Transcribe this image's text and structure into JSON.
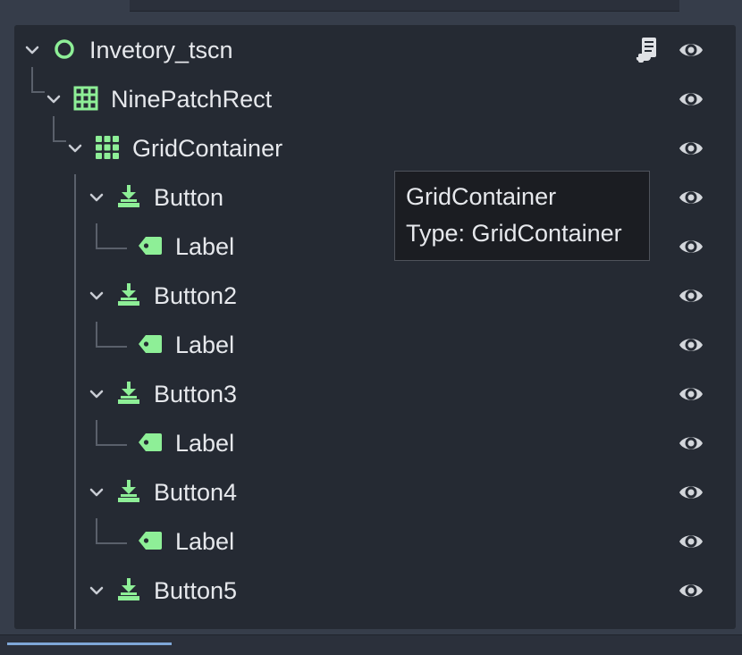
{
  "tree": {
    "nodes": [
      {
        "label": "Invetory_tscn",
        "icon": "node-circle-icon",
        "depth": 0
      },
      {
        "label": "NinePatchRect",
        "icon": "ninepatchrect-icon",
        "depth": 1
      },
      {
        "label": "GridContainer",
        "icon": "gridcontainer-icon",
        "depth": 2
      },
      {
        "label": "Button",
        "icon": "button-icon",
        "depth": 3
      },
      {
        "label": "Label",
        "icon": "label-icon",
        "depth": 4
      },
      {
        "label": "Button2",
        "icon": "button-icon",
        "depth": 3
      },
      {
        "label": "Label",
        "icon": "label-icon",
        "depth": 4
      },
      {
        "label": "Button3",
        "icon": "button-icon",
        "depth": 3
      },
      {
        "label": "Label",
        "icon": "label-icon",
        "depth": 4
      },
      {
        "label": "Button4",
        "icon": "button-icon",
        "depth": 3
      },
      {
        "label": "Label",
        "icon": "label-icon",
        "depth": 4
      },
      {
        "label": "Button5",
        "icon": "button-icon",
        "depth": 3
      }
    ]
  },
  "tooltip": {
    "name": "GridContainer",
    "type_line": "Type: GridContainer"
  },
  "colors": {
    "node_green": "#8eef97",
    "background": "#252a33",
    "text": "#e6e8ec"
  }
}
